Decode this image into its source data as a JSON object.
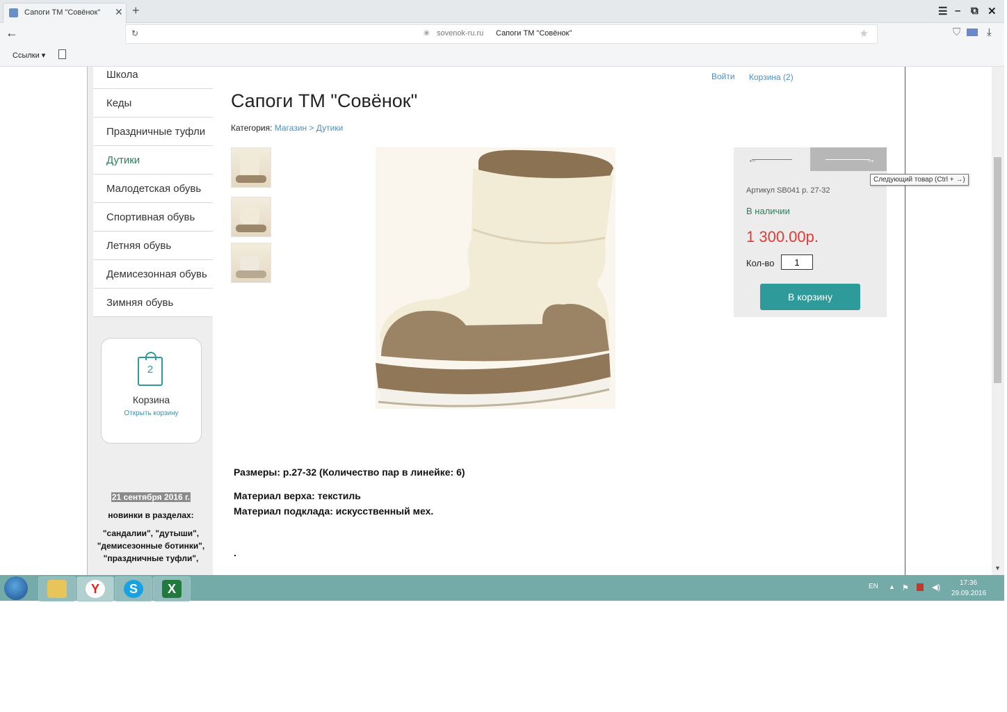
{
  "browser": {
    "tab_title": "Сапоги ТМ \"Совёнок\"",
    "tab_close": "✕",
    "new_tab": "+",
    "url_domain": "sovenok-ru.ru",
    "url_title": "Сапоги ТМ \"Совёнок\"",
    "bookmarks_links": "Ссылки ▾",
    "window_buttons": {
      "menu": "☰",
      "minimize": "–",
      "restore": "⧉",
      "close": "✕"
    }
  },
  "header": {
    "login": "Войти",
    "cart_link": "Корзина (2)"
  },
  "sidebar": {
    "categories": [
      {
        "label": "Школа"
      },
      {
        "label": "Кеды"
      },
      {
        "label": "Праздничные туфли"
      },
      {
        "label": "Дутики",
        "active": true
      },
      {
        "label": "Малодетская обувь"
      },
      {
        "label": "Спортивная обувь"
      },
      {
        "label": "Летняя обувь"
      },
      {
        "label": "Демисезонная обувь"
      },
      {
        "label": "Зимняя обувь"
      }
    ],
    "cart_widget": {
      "count": "2",
      "label": "Корзина",
      "open_link": "Открыть корзину"
    },
    "news": {
      "date": "21 сентября 2016 г.",
      "intro": "новинки в разделах:",
      "body": "\"сандалии\", \"дутыши\", \"демисезонные ботинки\", \"праздничные туфли\","
    }
  },
  "product": {
    "title": "Сапоги ТМ \"Совёнок\"",
    "breadcrumb": {
      "label": "Категория:",
      "shop": "Магазин",
      "separator": ">",
      "category": "Дутики"
    },
    "sku": "Артикул SB041 р. 27-32",
    "availability": "В наличии",
    "price": "1 300.00р.",
    "quantity_label": "Кол-во",
    "quantity_value": "1",
    "add_to_cart": "В корзину",
    "next_tooltip": "Следующий товар (Ctrl + →)",
    "description": {
      "sizes": "Размеры: р.27-32 (Количество пар в линейке: 6)",
      "upper": "Материал верха: текстиль",
      "lining": "Материал подклада: искусственный мех.",
      "dot": "."
    }
  },
  "taskbar": {
    "apps": [
      "folder-icon",
      "yandex-browser-icon",
      "skype-icon",
      "excel-icon"
    ],
    "lang": "EN",
    "time": "17:36",
    "date": "29.09.2016"
  },
  "colors": {
    "accent_teal": "#2f9a9a",
    "price_red": "#e53935",
    "link_blue": "#4a8fc9",
    "in_stock_green": "#2e7d5a",
    "taskbar": "#74aaa8"
  }
}
